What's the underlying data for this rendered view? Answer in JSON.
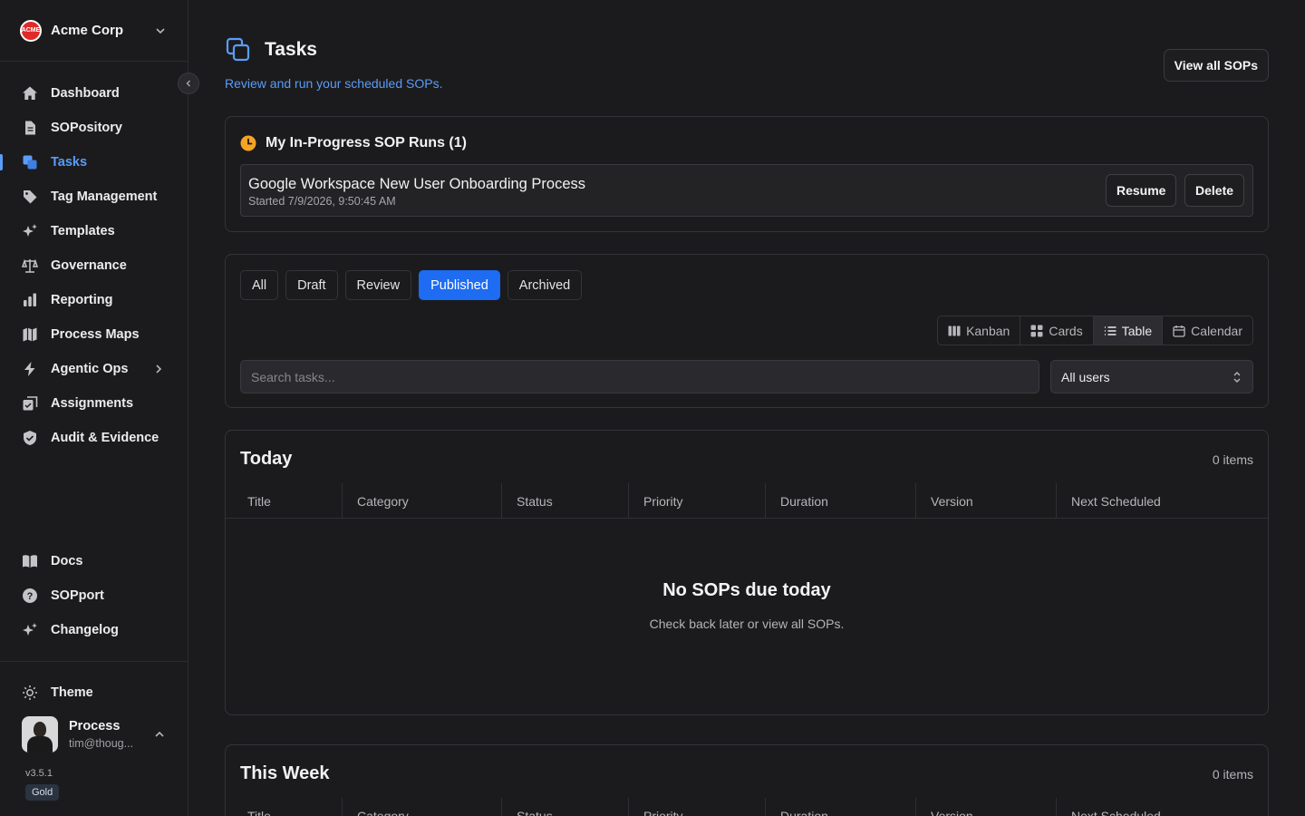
{
  "org": {
    "name": "Acme Corp",
    "logo_text": "ACME"
  },
  "sidebar": {
    "items": [
      {
        "label": "Dashboard",
        "icon": "home-icon"
      },
      {
        "label": "SOPository",
        "icon": "document-icon"
      },
      {
        "label": "Tasks",
        "icon": "copy-icon",
        "active": true
      },
      {
        "label": "Tag Management",
        "icon": "tag-icon"
      },
      {
        "label": "Templates",
        "icon": "sparkles-icon"
      },
      {
        "label": "Governance",
        "icon": "scale-icon"
      },
      {
        "label": "Reporting",
        "icon": "bar-chart-icon"
      },
      {
        "label": "Process Maps",
        "icon": "map-icon"
      },
      {
        "label": "Agentic Ops",
        "icon": "bolt-icon",
        "has_submenu": true
      },
      {
        "label": "Assignments",
        "icon": "assignment-icon"
      },
      {
        "label": "Audit & Evidence",
        "icon": "shield-check-icon"
      }
    ],
    "bottom_items": [
      {
        "label": "Docs",
        "icon": "book-icon"
      },
      {
        "label": "SOPport",
        "icon": "help-circle-icon"
      },
      {
        "label": "Changelog",
        "icon": "sparkles-icon"
      }
    ],
    "theme_label": "Theme",
    "user": {
      "name": "Process",
      "email": "tim@thoug..."
    },
    "version": "v3.5.1",
    "plan": "Gold"
  },
  "page": {
    "title": "Tasks",
    "subtitle": "Review and run your scheduled SOPs.",
    "view_all_label": "View all SOPs"
  },
  "in_progress": {
    "title": "My In-Progress SOP Runs (1)",
    "runs": [
      {
        "name": "Google Workspace New User Onboarding Process",
        "started": "Started 7/9/2026, 9:50:45 AM",
        "resume_label": "Resume",
        "delete_label": "Delete"
      }
    ]
  },
  "filters": {
    "tabs": [
      "All",
      "Draft",
      "Review",
      "Published",
      "Archived"
    ],
    "active_tab": "Published",
    "views": [
      "Kanban",
      "Cards",
      "Table",
      "Calendar"
    ],
    "active_view": "Table",
    "search_placeholder": "Search tasks...",
    "user_filter": "All users"
  },
  "table_columns": [
    "Title",
    "Category",
    "Status",
    "Priority",
    "Duration",
    "Version",
    "Next Scheduled"
  ],
  "sections": [
    {
      "title": "Today",
      "count": "0 items",
      "empty_title": "No SOPs due today",
      "empty_sub": "Check back later or view all SOPs."
    },
    {
      "title": "This Week",
      "count": "0 items"
    }
  ],
  "colors": {
    "accent": "#5b9cf8",
    "primary_button": "#1d6cf2",
    "in_progress_icon": "#f5a524",
    "background": "#1b1b1d"
  }
}
